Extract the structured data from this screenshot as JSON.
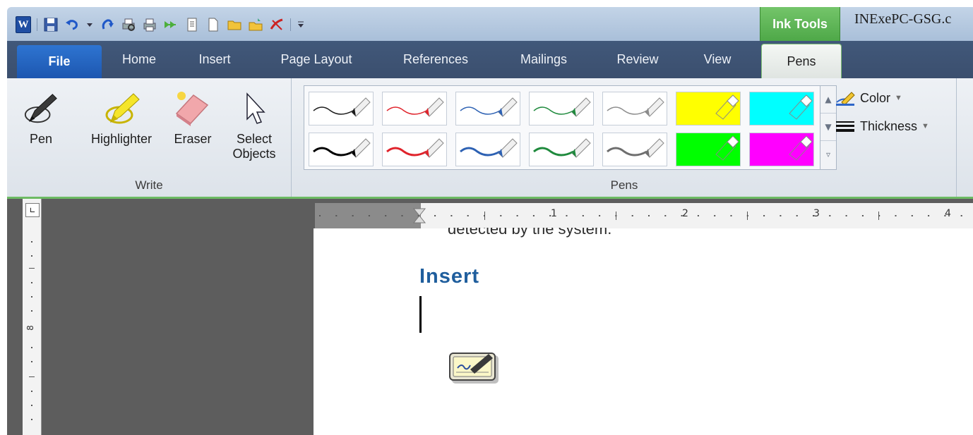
{
  "quick_access": {
    "icons": [
      "word-logo-icon",
      "save-icon",
      "undo-icon",
      "dropdown-icon",
      "redo-icon",
      "print-preview-icon",
      "print-icon",
      "forward-icon",
      "document-icon",
      "new-icon",
      "open-icon",
      "folder-icon",
      "ink-icon",
      "customize-icon"
    ],
    "logo_letter": "W"
  },
  "title_bar": {
    "context_tab": "Ink Tools",
    "document_title": "INExePC-GSG.c"
  },
  "tabs": [
    {
      "label": "File"
    },
    {
      "label": "Home"
    },
    {
      "label": "Insert"
    },
    {
      "label": "Page Layout"
    },
    {
      "label": "References"
    },
    {
      "label": "Mailings"
    },
    {
      "label": "Review"
    },
    {
      "label": "View"
    },
    {
      "label": "Pens"
    }
  ],
  "ribbon": {
    "write_group": {
      "label": "Write",
      "buttons": [
        {
          "label": "Pen",
          "icon": "pen-icon"
        },
        {
          "label": "Highlighter",
          "icon": "highlighter-icon"
        },
        {
          "label": "Eraser",
          "icon": "eraser-icon"
        },
        {
          "label_line1": "Select",
          "label_line2": "Objects",
          "icon": "select-objects-icon"
        }
      ]
    },
    "pens_group": {
      "label": "Pens",
      "pens_row1": [
        {
          "kind": "pen",
          "color": "#1a1a1a"
        },
        {
          "kind": "pen",
          "color": "#e0232b"
        },
        {
          "kind": "pen",
          "color": "#2d61b3"
        },
        {
          "kind": "pen",
          "color": "#1f8a3d"
        },
        {
          "kind": "pen",
          "color": "#8c8c8c"
        },
        {
          "kind": "highlighter",
          "color": "#ffff00"
        },
        {
          "kind": "highlighter",
          "color": "#00ffff"
        }
      ],
      "pens_row2": [
        {
          "kind": "pen",
          "color": "#000000"
        },
        {
          "kind": "pen",
          "color": "#e0232b"
        },
        {
          "kind": "pen",
          "color": "#2d61b3"
        },
        {
          "kind": "pen",
          "color": "#1f8a3d"
        },
        {
          "kind": "pen",
          "color": "#6e6e6e"
        },
        {
          "kind": "highlighter",
          "color": "#00ff00"
        },
        {
          "kind": "highlighter",
          "color": "#ff00ff"
        }
      ],
      "color_label": "Color",
      "thickness_label": "Thickness"
    }
  },
  "ruler": {
    "numbers": [
      "1",
      "2",
      "3",
      "4"
    ],
    "vertical_number": "8"
  },
  "document": {
    "cut_off_line": "detected by the system.",
    "heading": "Insert"
  },
  "colors": {
    "accent_green": "#6dbb63",
    "file_tab": "#2563c4",
    "heading_blue": "#1f5e9d"
  }
}
